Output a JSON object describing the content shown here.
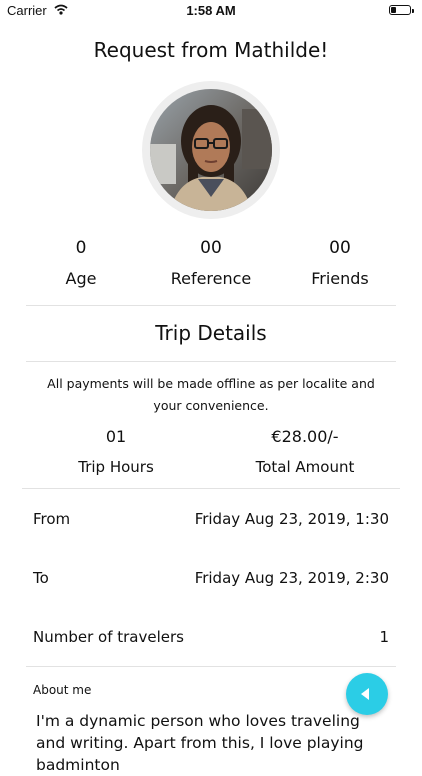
{
  "status_bar": {
    "carrier": "Carrier",
    "time": "1:58 AM"
  },
  "header": {
    "title": "Request from Mathilde!"
  },
  "profile": {
    "avatar": "photo",
    "stats": [
      {
        "value": "0",
        "label": "Age"
      },
      {
        "value": "00",
        "label": "Reference"
      },
      {
        "value": "00",
        "label": "Friends"
      }
    ]
  },
  "trip": {
    "title": "Trip Details",
    "notice": "All payments will be made offline as per localite and your convenience.",
    "hours": {
      "value": "01",
      "label": "Trip Hours"
    },
    "amount": {
      "value": "€28.00/-",
      "label": "Total Amount"
    },
    "rows": [
      {
        "label": "From",
        "value": "Friday Aug 23, 2019, 1:30"
      },
      {
        "label": "To",
        "value": "Friday Aug 23, 2019, 2:30"
      },
      {
        "label": "Number of travelers",
        "value": "1"
      }
    ]
  },
  "about": {
    "label": "About me",
    "text": "I'm a dynamic person who loves traveling and writing. Apart from this, I love playing badminton"
  },
  "fab": {
    "icon": "back-arrow-icon",
    "color": "#2bcde6"
  }
}
